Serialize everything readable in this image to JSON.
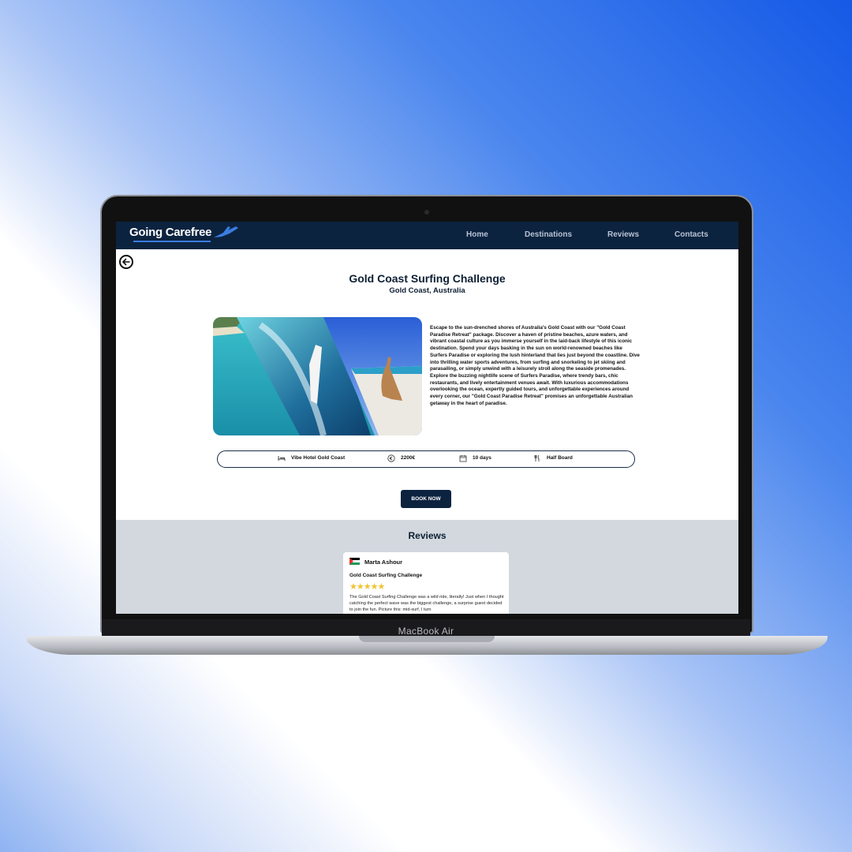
{
  "device": {
    "label": "MacBook Air"
  },
  "nav": {
    "logo": "Going Carefree",
    "items": [
      "Home",
      "Destinations",
      "Reviews",
      "Contacts"
    ]
  },
  "page": {
    "title": "Gold Coast Surfing Challenge",
    "location": "Gold Coast, Australia",
    "description": "Escape to the sun-drenched shores of Australia's Gold Coast with our \"Gold Coast Paradise Retreat\" package. Discover a haven of pristine beaches, azure waters, and vibrant coastal culture as you immerse yourself in the laid-back lifestyle of this iconic destination. Spend your days basking in the sun on world-renowned beaches like Surfers Paradise or exploring the lush hinterland that lies just beyond the coastline. Dive into thrilling water sports adventures, from surfing and snorkeling to jet skiing and parasailing, or simply unwind with a leisurely stroll along the seaside promenades. Explore the buzzing nightlife scene of Surfers Paradise, where trendy bars, chic restaurants, and lively entertainment venues await. With luxurious accommodations overlooking the ocean, expertly guided tours, and unforgettable experiences around every corner, our \"Gold Coast Paradise Retreat\" promises an unforgettable Australian getaway in the heart of paradise.",
    "details": {
      "hotel": "Vibe Hotel Gold Coast",
      "price": "2200€",
      "duration": "10 days",
      "board": "Half Board"
    },
    "book_label": "BOOK NOW"
  },
  "reviews": {
    "title": "Reviews",
    "items": [
      {
        "name": "Marta Ashour",
        "trip": "Gold Coast Surfing Challenge",
        "stars": "★★★★★",
        "text": "The Gold Coast Surfing Challenge was a wild ride, literally! Just when I thought catching the perfect wave was the biggest challenge, a surprise guest decided to join the fun. Picture this: mid-surf, I turn"
      }
    ]
  },
  "colors": {
    "nav_bg": "#0c2340",
    "accent": "#3a7de0",
    "reviews_bg": "#d2d8de",
    "star": "#f2c233"
  }
}
